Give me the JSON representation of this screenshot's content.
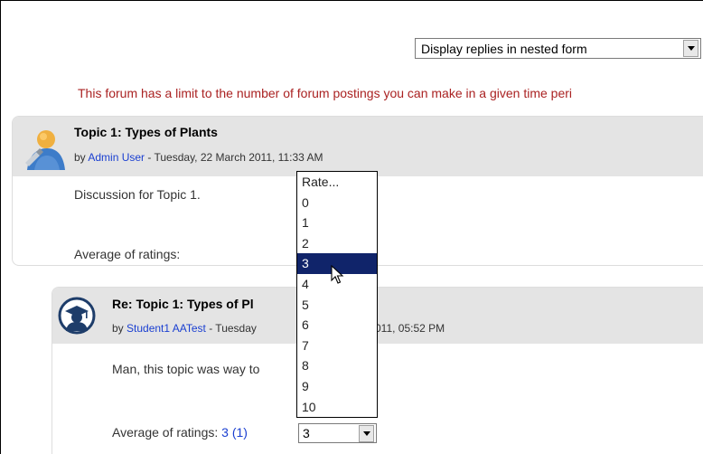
{
  "display_select": {
    "value": "Display replies in nested form"
  },
  "notice": "This forum has a limit to the number of forum postings you can make in a given time peri",
  "post1": {
    "title": "Topic 1: Types of Plants",
    "by_prefix": "by ",
    "author": "Admin User",
    "date": " - Tuesday, 22 March 2011, 11:33 AM",
    "message": "Discussion for Topic 1.",
    "avg_label": "Average of ratings:"
  },
  "post2": {
    "title": "Re: Topic 1: Types of Pl",
    "by_prefix": "by ",
    "author": "Student1 AATest",
    "date_a": " - Tuesday",
    "date_b": "011, 05:52 PM",
    "message": "Man, this topic was way to",
    "avg_label": "Average of ratings: ",
    "avg_value": "3 (1)",
    "rating_value": "3"
  },
  "rating_dropdown": {
    "options": [
      "Rate...",
      "0",
      "1",
      "2",
      "3",
      "4",
      "5",
      "6",
      "7",
      "8",
      "9",
      "10"
    ],
    "selected_index": 4
  },
  "icons": {
    "avatar1": "admin-user-avatar-icon",
    "avatar2": "graduate-student-avatar-icon",
    "cursor": "mouse-pointer-icon"
  }
}
